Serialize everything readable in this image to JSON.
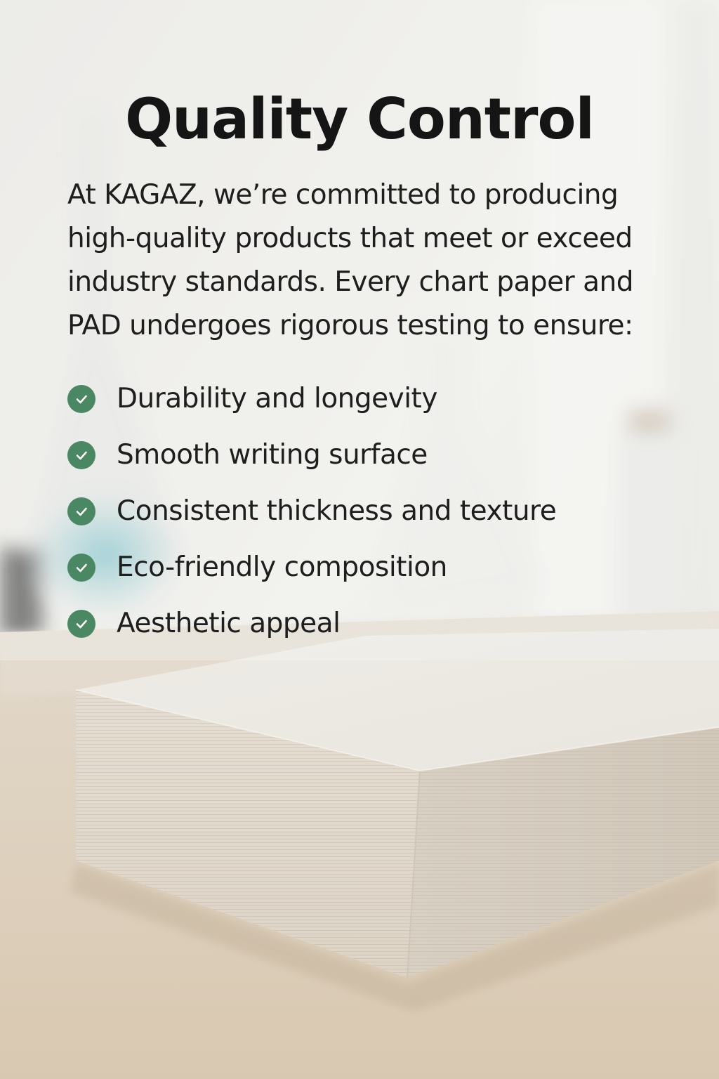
{
  "header": {
    "title": "Quality Control"
  },
  "intro": {
    "text": "At KAGAZ, we’re committed to producing high-quality products that meet or exceed industry standards. Every chart paper and PAD undergoes rigorous testing to ensure:"
  },
  "checklist": {
    "icon": "check-circle-icon",
    "icon_color": "#4a8763",
    "items": [
      {
        "label": "Durability and longevity"
      },
      {
        "label": "Smooth writing surface"
      },
      {
        "label": "Consistent thickness and texture"
      },
      {
        "label": "Eco-friendly composition"
      },
      {
        "label": "Aesthetic appeal"
      }
    ]
  },
  "colors": {
    "background": "#eeede9",
    "accent": "#4a8763",
    "text": "#1e1e1e"
  }
}
